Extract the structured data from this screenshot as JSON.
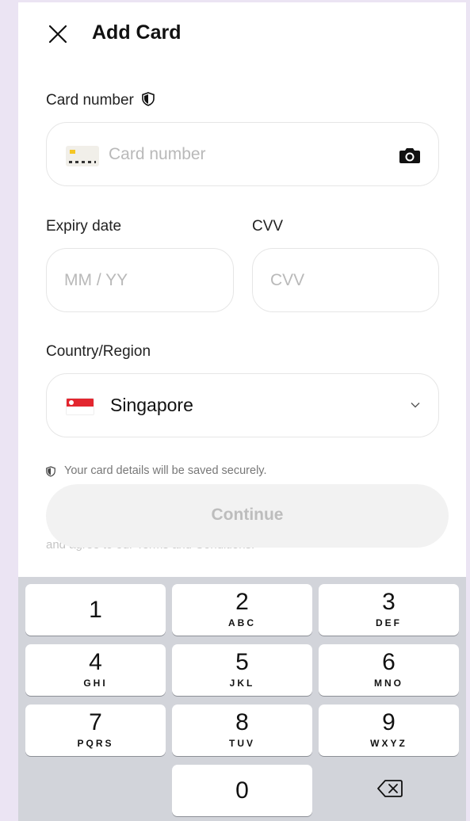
{
  "header": {
    "title": "Add Card",
    "close_icon": "close-icon"
  },
  "card_number": {
    "label": "Card number",
    "placeholder": "Card number",
    "label_icon": "shield-icon",
    "card_icon": "credit-card-icon",
    "scan_icon": "camera-icon"
  },
  "expiry": {
    "label": "Expiry date",
    "placeholder": "MM / YY"
  },
  "cvv": {
    "label": "CVV",
    "placeholder": "CVV"
  },
  "country": {
    "label": "Country/Region",
    "value": "Singapore",
    "flag_icon": "singapore-flag-icon",
    "dropdown_icon": "chevron-down-icon"
  },
  "secure_note": "Your card details will be saved securely.",
  "continue_label": "Continue",
  "terms_text": "and agree to our Terms and Conditions.",
  "keyboard": {
    "keys": [
      {
        "num": "1",
        "letters": ""
      },
      {
        "num": "2",
        "letters": "ABC"
      },
      {
        "num": "3",
        "letters": "DEF"
      },
      {
        "num": "4",
        "letters": "GHI"
      },
      {
        "num": "5",
        "letters": "JKL"
      },
      {
        "num": "6",
        "letters": "MNO"
      },
      {
        "num": "7",
        "letters": "PQRS"
      },
      {
        "num": "8",
        "letters": "TUV"
      },
      {
        "num": "9",
        "letters": "WXYZ"
      },
      {
        "num": "0",
        "letters": ""
      }
    ],
    "backspace_icon": "backspace-icon"
  },
  "colors": {
    "page_background": "#ebe4f3",
    "keyboard_background": "#d2d4da",
    "flag_red": "#e3262f",
    "card_chip": "#f5c623"
  }
}
